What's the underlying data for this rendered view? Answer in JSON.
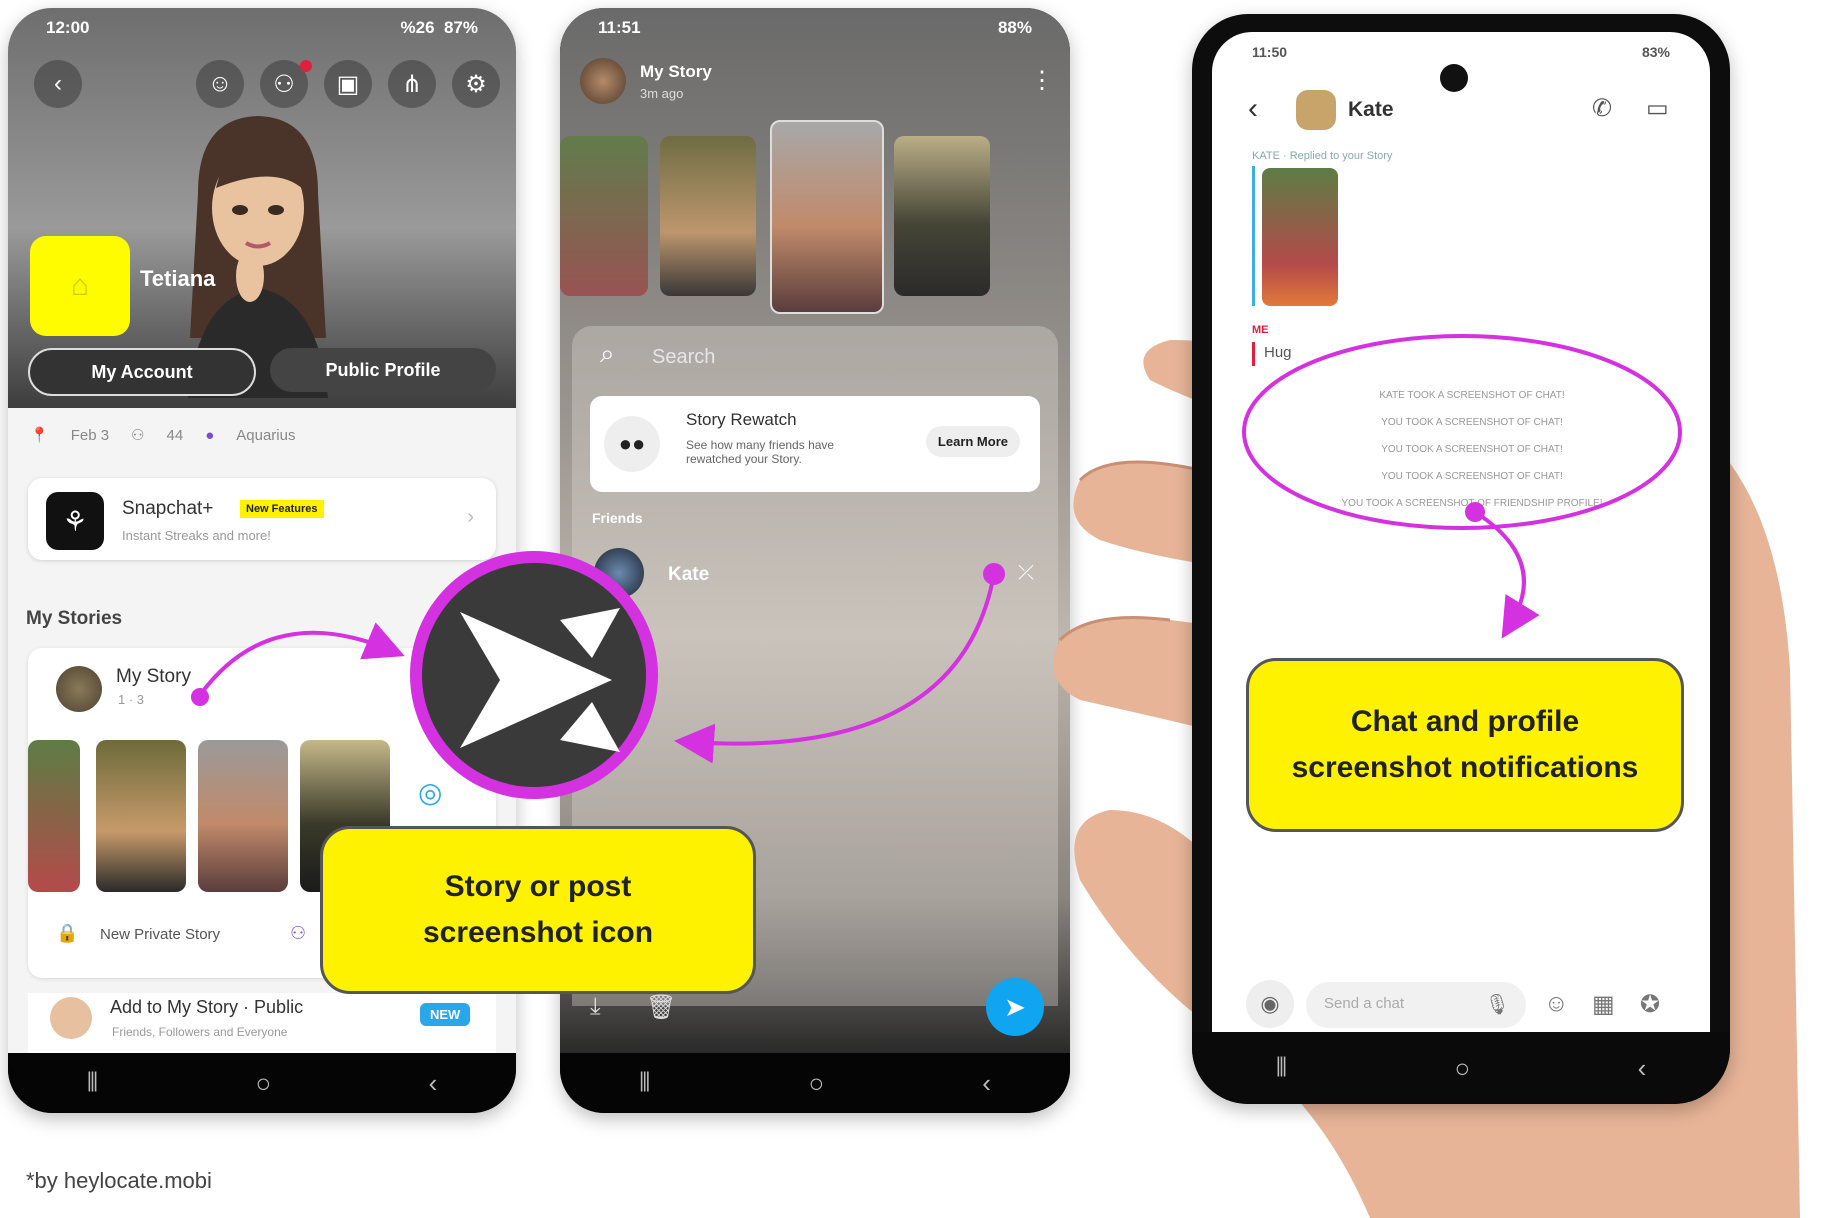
{
  "phone1": {
    "status_time": "12:00",
    "status_icons": "⁠%26 ⁠⁠⁠ 87%",
    "profile_name": "Tetiana",
    "btn_account": "My Account",
    "btn_public": "Public Profile",
    "info_date": "Feb 3",
    "info_count": "44",
    "info_sign": "Aquarius",
    "snapplus_title": "Snapchat+",
    "snapplus_badge": "New Features",
    "snapplus_sub": "Instant Streaks and more!",
    "section_title": "My Stories",
    "story_title": "My Story",
    "story_meta": "1 · 3",
    "private_story": "New Private Story",
    "add_story": "Add to My Story · Public",
    "add_story_sub": "Friends, Followers and Everyone",
    "new_badge": "NEW"
  },
  "phone2": {
    "status_time": "11:51",
    "status_icons": "88%",
    "story_title": "My Story",
    "story_sub": "3m ago",
    "search_placeholder": "Search",
    "rewatch_title": "Story Rewatch",
    "rewatch_sub": "See how many friends have rewatched your Story.",
    "learn_more": "Learn More",
    "friends_label": "Friends",
    "friend_name": "Kate"
  },
  "phone3": {
    "status_time": "11:50",
    "status_icons": "83%",
    "contact_name": "Kate",
    "reply_label": "KATE · Replied to your Story",
    "me_label": "ME",
    "hug_text": "Hug",
    "notifications": [
      "KATE TOOK A SCREENSHOT OF CHAT!",
      "YOU TOOK A SCREENSHOT OF CHAT!",
      "YOU TOOK A SCREENSHOT OF CHAT!",
      "YOU TOOK A SCREENSHOT OF CHAT!",
      "YOU TOOK A SCREENSHOT OF FRIENDSHIP PROFILE!"
    ],
    "chat_placeholder": "Send a chat"
  },
  "callouts": {
    "story_icon_line1": "Story or post",
    "story_icon_line2": "screenshot icon",
    "chat_line1": "Chat and profile",
    "chat_line2": "screenshot notifications"
  },
  "footer": {
    "credit": "*by heylocate.mobi"
  },
  "colors": {
    "accent_magenta": "#d431e0",
    "callout_yellow": "#fff200",
    "snap_yellow": "#fffc00",
    "send_blue": "#0fa5f0"
  }
}
